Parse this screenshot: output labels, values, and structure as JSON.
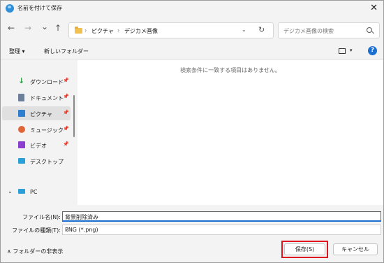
{
  "window": {
    "title": "名前を付けて保存"
  },
  "nav": {
    "back": "←",
    "forward": "→",
    "recent": "⌄",
    "up": "↑",
    "breadcrumb": [
      "ピクチャ",
      "デジカメ画像"
    ],
    "separator": "›",
    "search_placeholder": "デジカメ画像の検索"
  },
  "toolbar": {
    "organize": "整理 ▾",
    "new_folder": "新しいフォルダー"
  },
  "sidebar": {
    "items": [
      {
        "label": "ダウンロード",
        "icon": "download-icon",
        "color": "#2e9e48",
        "pinned": true,
        "selected": false
      },
      {
        "label": "ドキュメント",
        "icon": "document-icon",
        "color": "#6e7f99",
        "pinned": true,
        "selected": false
      },
      {
        "label": "ピクチャ",
        "icon": "picture-icon",
        "color": "#2f7fd0",
        "pinned": true,
        "selected": true
      },
      {
        "label": "ミュージック",
        "icon": "music-icon",
        "color": "#e0663a",
        "pinned": true,
        "selected": false
      },
      {
        "label": "ビデオ",
        "icon": "video-icon",
        "color": "#8a3fd1",
        "pinned": true,
        "selected": false
      },
      {
        "label": "デスクトップ",
        "icon": "desktop-icon",
        "color": "#2b9fd8",
        "pinned": false,
        "selected": false
      }
    ],
    "pc_label": "PC"
  },
  "content": {
    "empty_message": "検索条件に一致する項目はありません。"
  },
  "fields": {
    "filename_label": "ファイル名(N):",
    "filename_value": "背景削除済み",
    "filetype_label": "ファイルの種類(T):",
    "filetype_value": "PNG (*.png)"
  },
  "footer": {
    "hide_folders": "∧ フォルダーの非表示",
    "save": "保存(S)",
    "cancel": "キャンセル"
  }
}
